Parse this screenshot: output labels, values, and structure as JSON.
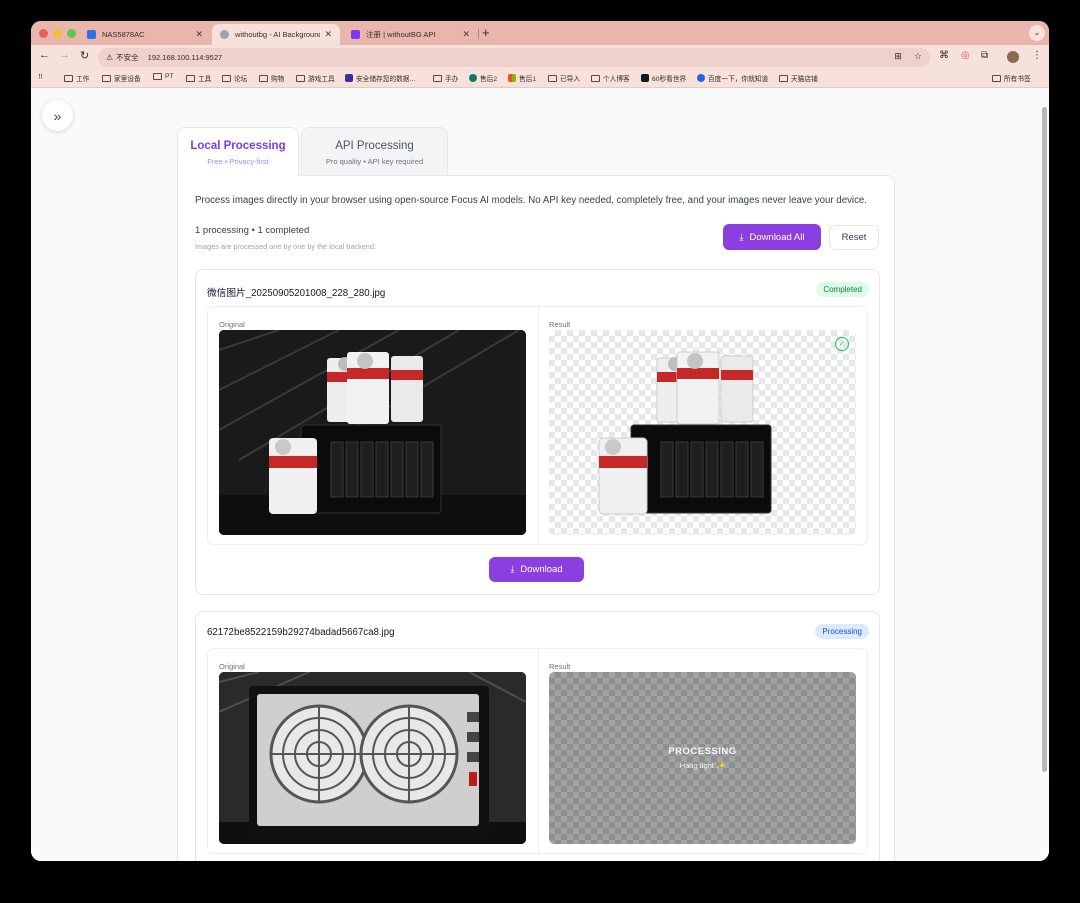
{
  "browser": {
    "tabs": [
      {
        "title": "NAS5878AC",
        "icon_color": "#2f6fe0"
      },
      {
        "title": "withoutbg - AI Background R",
        "icon_color": "#6b7280"
      },
      {
        "title": "注册 | withoutBG API",
        "icon_color": "#7c3aed"
      }
    ],
    "new_tab": "+",
    "tab_menu": "⌄",
    "security_label": "不安全",
    "url": "192.168.100.114:9527",
    "bookmarks": [
      {
        "label": "工作",
        "type": "folder"
      },
      {
        "label": "家里设备",
        "type": "folder"
      },
      {
        "label": "PT",
        "type": "folder"
      },
      {
        "label": "工具",
        "type": "folder"
      },
      {
        "label": "论坛",
        "type": "folder"
      },
      {
        "label": "购物",
        "type": "folder"
      },
      {
        "label": "游戏工具",
        "type": "folder"
      },
      {
        "label": "安全储存您的数据...",
        "type": "site"
      },
      {
        "label": "手办",
        "type": "folder"
      },
      {
        "label": "售后2",
        "type": "site"
      },
      {
        "label": "售后1",
        "type": "site"
      },
      {
        "label": "已导入",
        "type": "folder"
      },
      {
        "label": "个人博客",
        "type": "folder"
      },
      {
        "label": "60秒看世界",
        "type": "site"
      },
      {
        "label": "百度一下，你就知道",
        "type": "site"
      },
      {
        "label": "天猫店铺",
        "type": "folder"
      }
    ],
    "all_bookmarks": "所有书签"
  },
  "tabs": {
    "local": {
      "title": "Local Processing",
      "subtitle": "Free • Privacy-first"
    },
    "api": {
      "title": "API Processing",
      "subtitle": "Pro quality • API key required"
    }
  },
  "description": "Process images directly in your browser using open-source Focus AI models. No API key needed, completely free, and your images never leave your device.",
  "queue": {
    "status": "1 processing • 1 completed",
    "note": "Images are processed one by one by the local backend.",
    "download_all": "Download All",
    "reset": "Reset"
  },
  "items": [
    {
      "filename": "微信图片_20250905201008_228_280.jpg",
      "status": "Completed",
      "original_label": "Original",
      "result_label": "Result",
      "download": "Download"
    },
    {
      "filename": "62172be8522159b29274badad5667ca8.jpg",
      "status": "Processing",
      "original_label": "Original",
      "result_label": "Result",
      "processing_title": "PROCESSING",
      "processing_sub": "Hang tight ✨"
    }
  ],
  "colors": {
    "accent": "#8b3fe0",
    "tab_active": "#7c3aed",
    "completed": "#15803d",
    "processing": "#1d4ed8"
  }
}
